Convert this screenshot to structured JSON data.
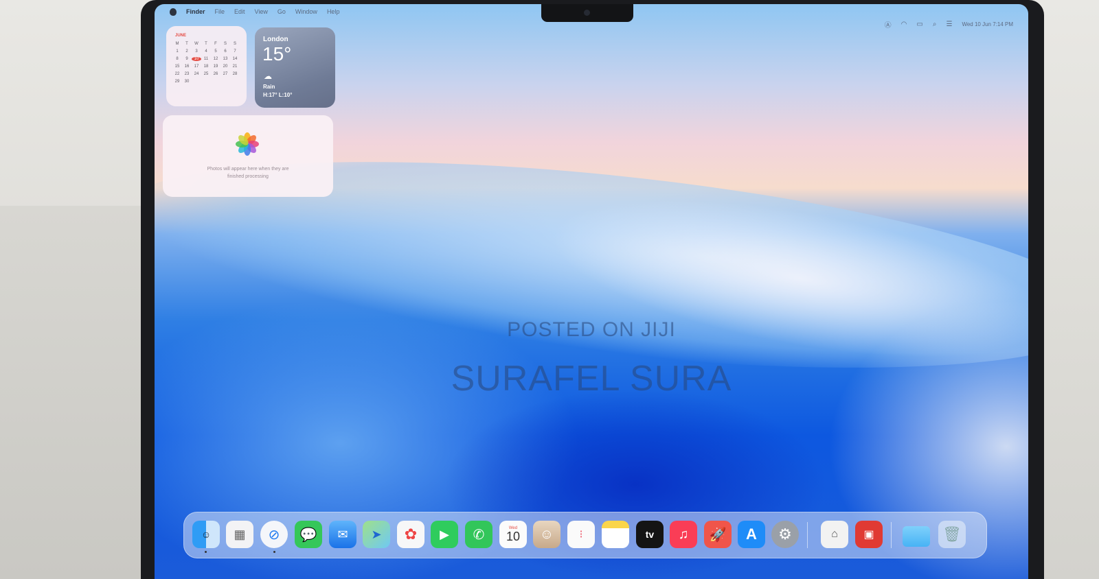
{
  "menubar": {
    "items": [
      "Finder",
      "File",
      "Edit",
      "View",
      "Go",
      "Window",
      "Help"
    ],
    "clock": "Wed 10 Jun  7:14 PM"
  },
  "calendar_widget": {
    "month": "JUNE",
    "weekdays": [
      "M",
      "T",
      "W",
      "T",
      "F",
      "S",
      "S"
    ],
    "days": [
      "1",
      "2",
      "3",
      "4",
      "5",
      "6",
      "7",
      "8",
      "9",
      "10",
      "11",
      "12",
      "13",
      "14",
      "15",
      "16",
      "17",
      "18",
      "19",
      "20",
      "21",
      "22",
      "23",
      "24",
      "25",
      "26",
      "27",
      "28",
      "29",
      "30"
    ],
    "today": "10"
  },
  "weather_widget": {
    "city": "London",
    "temp": "15°",
    "condition": "Rain",
    "hilo": "H:17° L:10°"
  },
  "photos_widget": {
    "message_line1": "Photos will appear here when they are",
    "message_line2": "finished processing"
  },
  "watermark": {
    "line1": "POSTED ON JIJI",
    "line2": "SURAFEL SURA"
  },
  "dock": {
    "calendar_day": "10",
    "calendar_weekday": "Wed",
    "appletv_label": "tv",
    "apps": [
      "finder-icon",
      "launchpad-icon",
      "safari-icon",
      "messages-icon",
      "mail-icon",
      "maps-icon",
      "photos-icon",
      "facetime-icon",
      "phone-icon",
      "calendar-icon",
      "contacts-icon",
      "reminders-icon",
      "notes-icon",
      "appletv-icon",
      "music-icon",
      "rocket-icon",
      "appstore-icon",
      "system-settings-icon",
      "preview-icon",
      "photo-booth-icon",
      "folder-icon",
      "trash-icon"
    ],
    "colors": {
      "messages": "#35c759",
      "facetime": "#2fcc5d",
      "music": "#fa3d56",
      "appstore": "#1e8cf8",
      "rocket": "#f0554a"
    }
  }
}
